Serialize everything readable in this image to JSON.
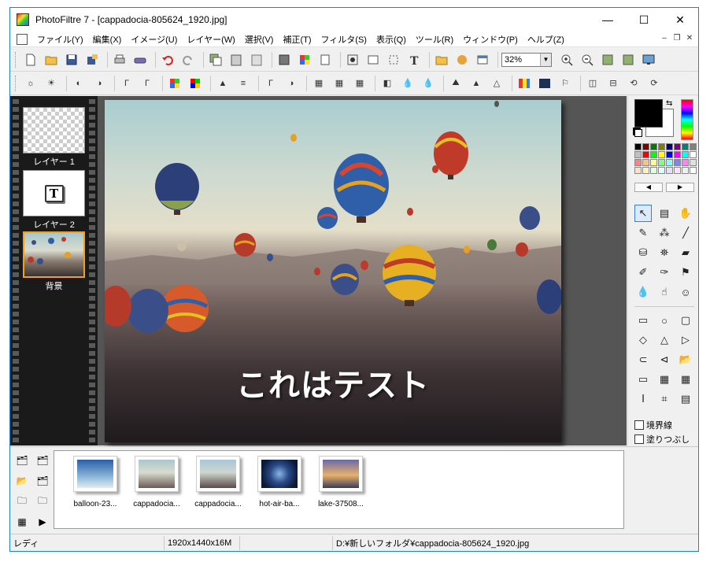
{
  "window": {
    "title": "PhotoFiltre 7 - [cappadocia-805624_1920.jpg]",
    "controls": {
      "minimize": "—",
      "maximize": "☐",
      "close": "✕"
    }
  },
  "menu": {
    "items": [
      "ファイル(Y)",
      "編集(X)",
      "イメージ(U)",
      "レイヤー(W)",
      "選択(V)",
      "補正(T)",
      "フィルタ(S)",
      "表示(Q)",
      "ツール(R)",
      "ウィンドウ(P)",
      "ヘルプ(Z)"
    ],
    "mdi": {
      "minimize": "–",
      "restore": "❐",
      "close": "✕"
    }
  },
  "toolbar": {
    "zoom_value": "32%"
  },
  "layers": [
    {
      "label": "レイヤー 1"
    },
    {
      "label": "レイヤー 2"
    },
    {
      "label": "背景"
    }
  ],
  "canvas": {
    "overlay_text": "これはテスト"
  },
  "tool_panel": {
    "colors": {
      "foreground": "#000000",
      "background": "#ffffff"
    },
    "checkbox_border": "境界線",
    "checkbox_fill": "塗りつぶし"
  },
  "explorer": {
    "files": [
      {
        "name": "balloon-23..."
      },
      {
        "name": "cappadocia..."
      },
      {
        "name": "cappadocia..."
      },
      {
        "name": "hot-air-ba..."
      },
      {
        "name": "lake-37508..."
      }
    ]
  },
  "statusbar": {
    "status": "レディ",
    "image_info": "1920x1440x16M",
    "file_path": "D:¥新しいフォルダ¥cappadocia-805624_1920.jpg"
  }
}
